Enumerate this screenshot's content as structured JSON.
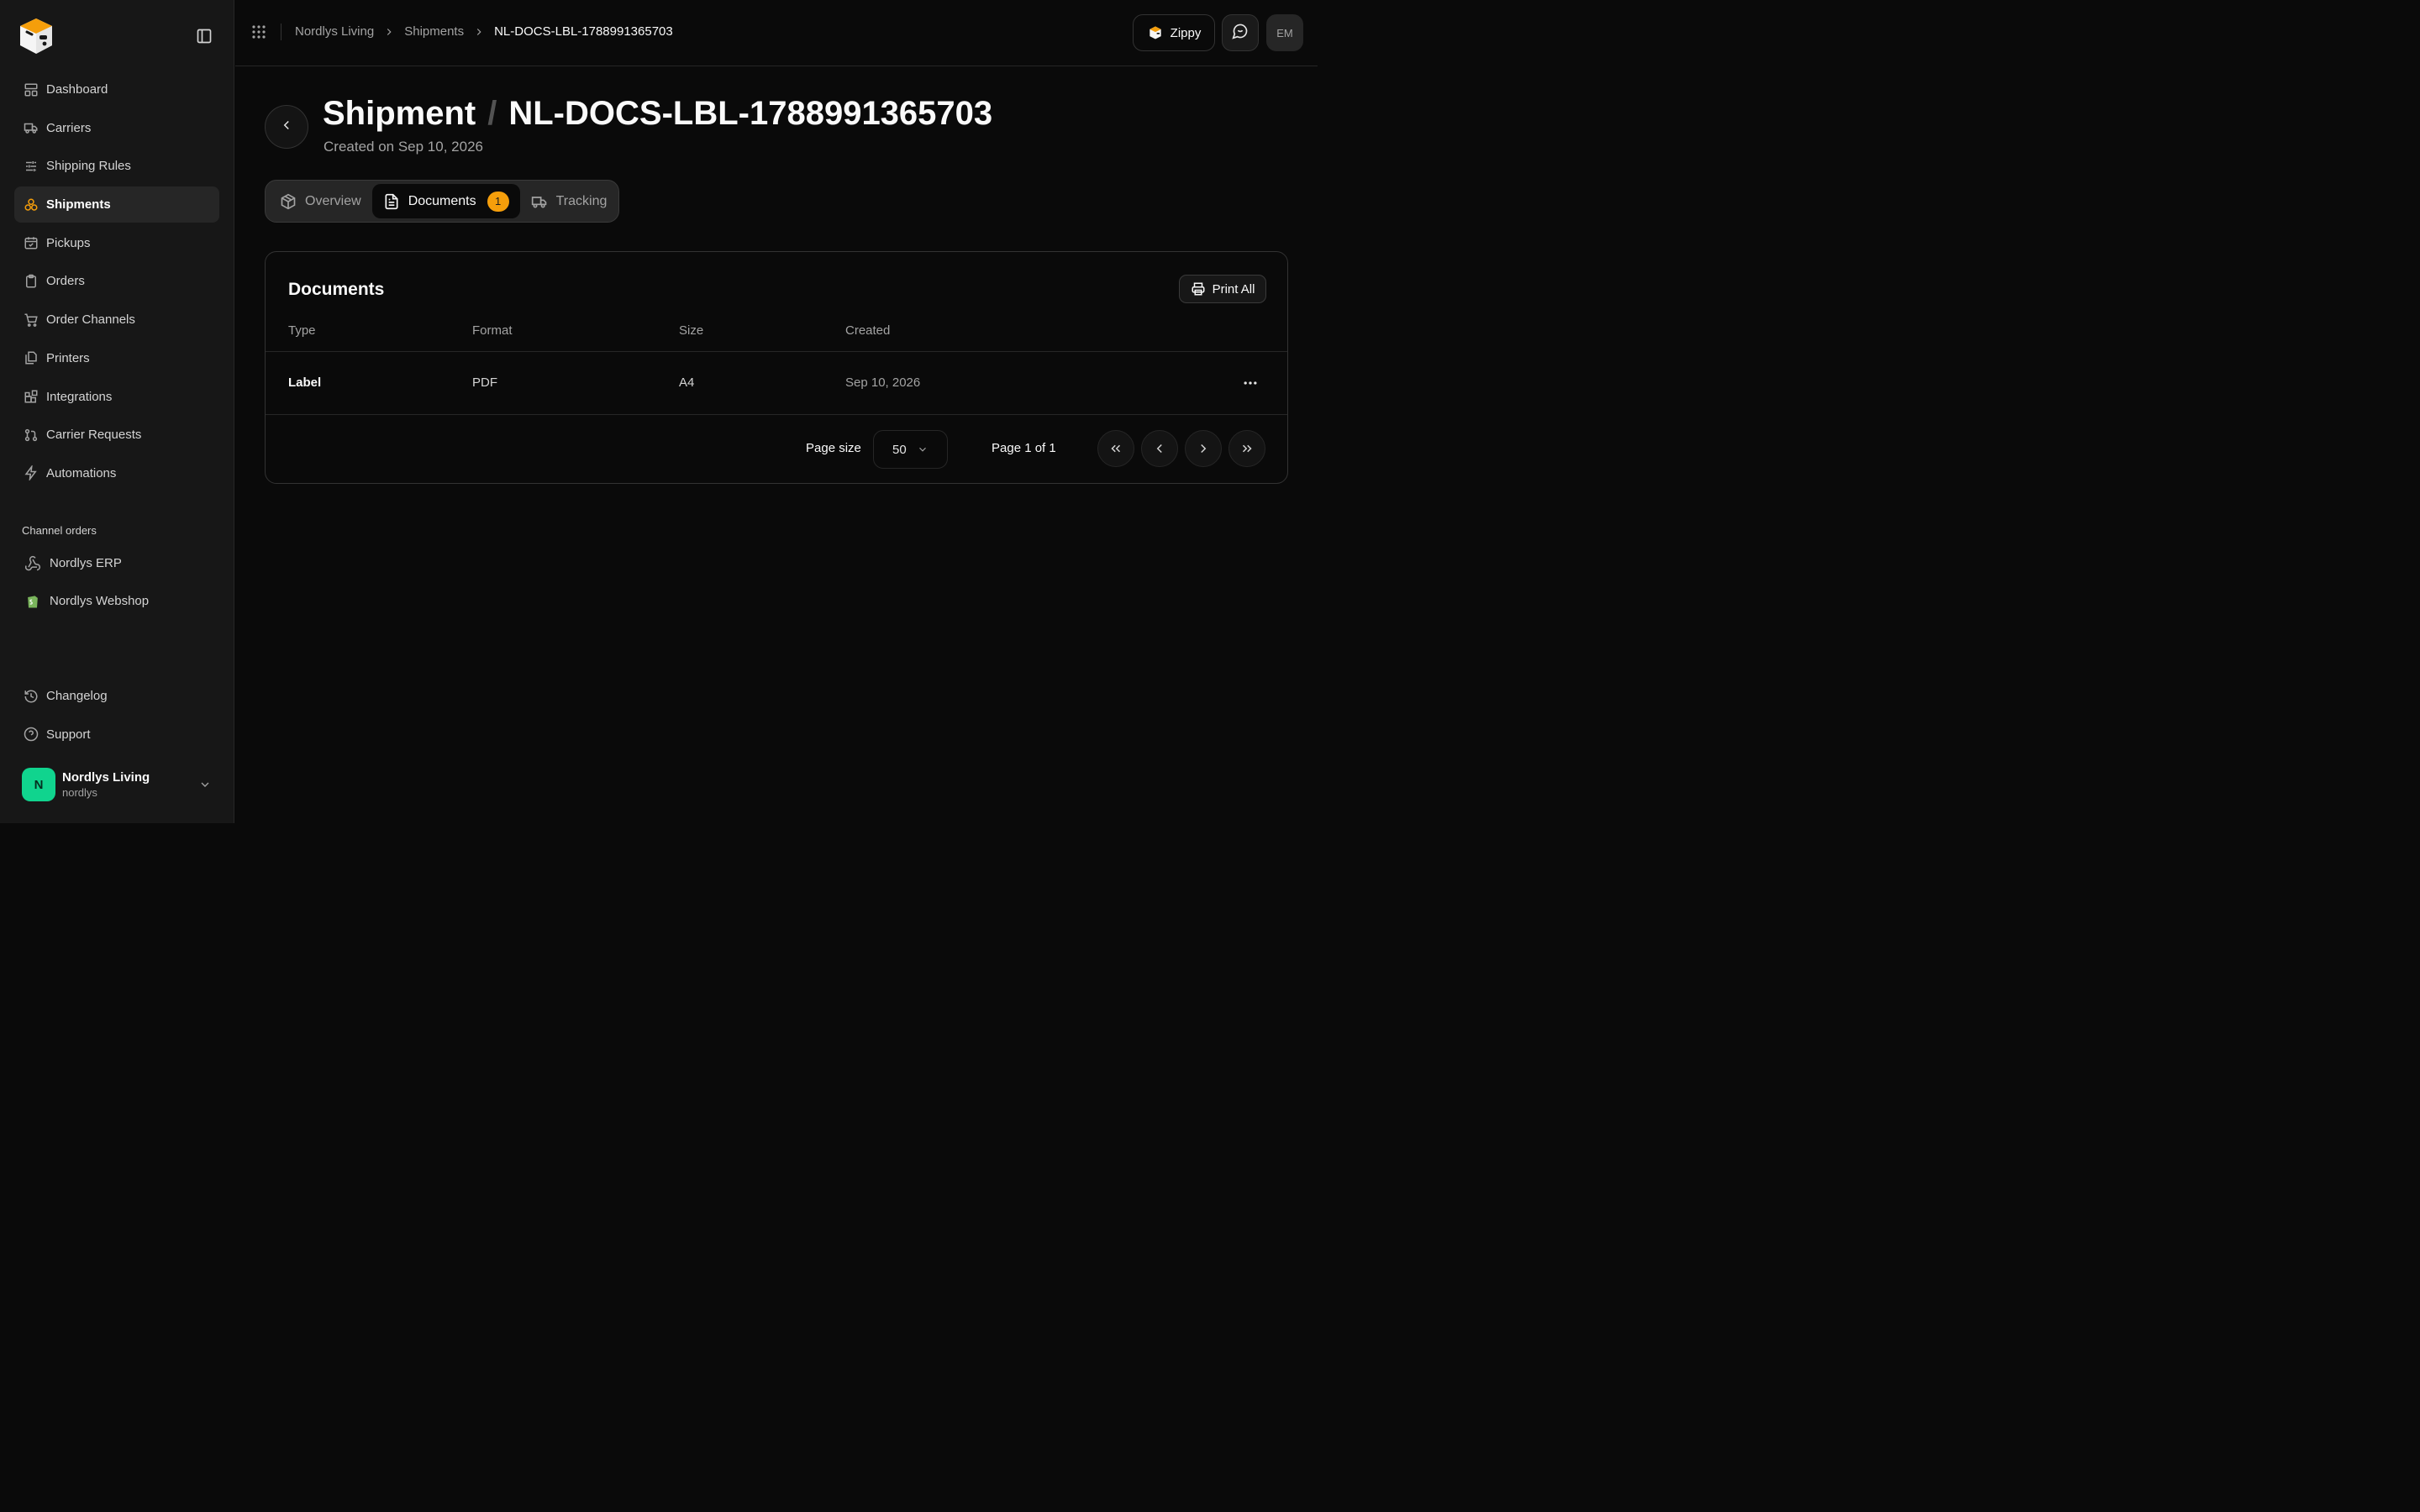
{
  "sidebar": {
    "items": [
      {
        "label": "Dashboard",
        "icon": "dashboard-icon"
      },
      {
        "label": "Carriers",
        "icon": "truck-icon"
      },
      {
        "label": "Shipping Rules",
        "icon": "sliders-icon"
      },
      {
        "label": "Shipments",
        "icon": "boxes-icon",
        "active": true
      },
      {
        "label": "Pickups",
        "icon": "calendar-check-icon"
      },
      {
        "label": "Orders",
        "icon": "clipboard-icon"
      },
      {
        "label": "Order Channels",
        "icon": "cart-icon"
      },
      {
        "label": "Printers",
        "icon": "printers-icon"
      },
      {
        "label": "Integrations",
        "icon": "blocks-icon"
      },
      {
        "label": "Carrier Requests",
        "icon": "git-pull-request-icon"
      },
      {
        "label": "Automations",
        "icon": "zap-icon"
      }
    ],
    "channel_section_label": "Channel orders",
    "channels": [
      {
        "label": "Nordlys ERP",
        "icon": "webhook-icon"
      },
      {
        "label": "Nordlys Webshop",
        "icon": "shopify-icon"
      }
    ],
    "bottom": [
      {
        "label": "Changelog",
        "icon": "history-icon"
      },
      {
        "label": "Support",
        "icon": "help-circle-icon"
      }
    ],
    "user": {
      "initial": "N",
      "name": "Nordlys Living",
      "handle": "nordlys"
    }
  },
  "topbar": {
    "breadcrumbs": [
      "Nordlys Living",
      "Shipments",
      "NL-DOCS-LBL-1788991365703"
    ],
    "zippy_label": "Zippy",
    "user_initials": "EM"
  },
  "header": {
    "title_prefix": "Shipment",
    "title_separator": "/",
    "title_id": "NL-DOCS-LBL-1788991365703",
    "subtitle": "Created on Sep 10, 2026"
  },
  "tabs": [
    {
      "label": "Overview",
      "icon": "package-icon"
    },
    {
      "label": "Documents",
      "icon": "file-text-icon",
      "badge": "1",
      "active": true
    },
    {
      "label": "Tracking",
      "icon": "truck-icon"
    }
  ],
  "documents": {
    "title": "Documents",
    "print_all_label": "Print All",
    "columns": [
      "Type",
      "Format",
      "Size",
      "Created"
    ],
    "rows": [
      {
        "type": "Label",
        "format": "PDF",
        "size": "A4",
        "created": "Sep 10, 2026"
      }
    ],
    "pagination": {
      "page_size_label": "Page size",
      "page_size": "50",
      "page_info": "Page 1 of 1"
    }
  },
  "colors": {
    "accent": "#f59e0b",
    "avatar": "#10d48e",
    "background": "#0a0a0a",
    "sidebar": "#171717"
  }
}
